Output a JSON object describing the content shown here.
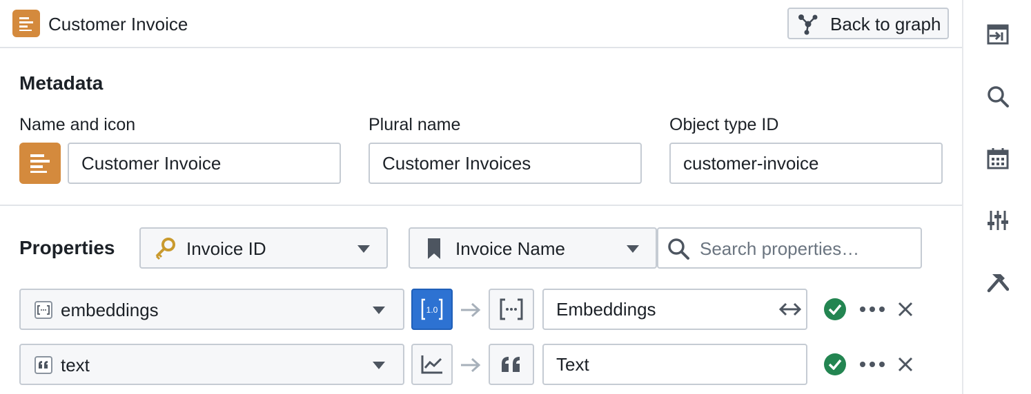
{
  "header": {
    "title": "Customer Invoice",
    "back_button_label": "Back to graph",
    "app_icon": "document-lines-icon"
  },
  "metadata": {
    "section_title": "Metadata",
    "name_label": "Name and icon",
    "name_value": "Customer Invoice",
    "plural_label": "Plural name",
    "plural_value": "Customer Invoices",
    "id_label": "Object type ID",
    "id_value": "customer-invoice"
  },
  "properties": {
    "section_title": "Properties",
    "primary_key_select": "Invoice ID",
    "title_select": "Invoice Name",
    "search_placeholder": "Search properties…",
    "rows": [
      {
        "source_name": "embeddings",
        "source_icon": "array-icon",
        "type_badge": "1.0",
        "type_active": true,
        "target_icon": "array-brackets-icon",
        "display_name": "Embeddings",
        "status": "valid"
      },
      {
        "source_name": "text",
        "source_icon": "quote-icon",
        "type_icon": "line-chart-icon",
        "type_active": false,
        "target_icon": "quote-icon",
        "display_name": "Text",
        "status": "valid"
      }
    ]
  },
  "right_sidebar": [
    "panel-insert-icon",
    "search-icon",
    "calendar-icon",
    "sliders-icon",
    "hammer-icon"
  ],
  "colors": {
    "accent_orange": "#d48a3d",
    "accent_blue": "#2d72d2",
    "success_green": "#238551"
  }
}
